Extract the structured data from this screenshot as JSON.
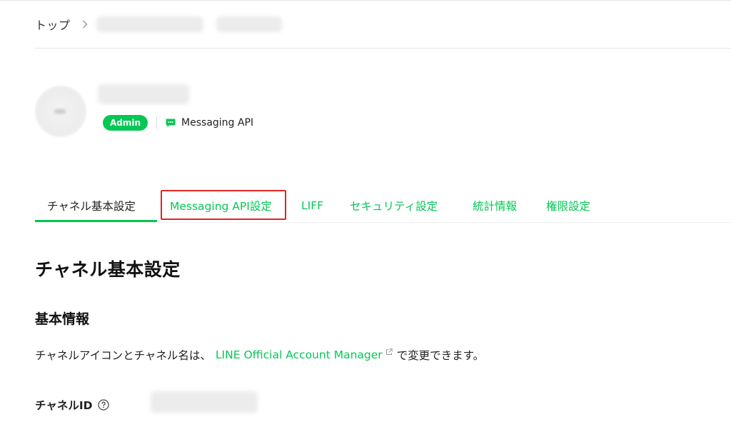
{
  "breadcrumb": {
    "home": "トップ"
  },
  "channel": {
    "role_badge": "Admin",
    "type": "Messaging API"
  },
  "tabs": [
    {
      "label": "チャネル基本設定",
      "active": true
    },
    {
      "label": "Messaging API設定",
      "active": false
    },
    {
      "label": "LIFF",
      "active": false
    },
    {
      "label": "セキュリティ設定",
      "active": false
    },
    {
      "label": "統計情報",
      "active": false
    },
    {
      "label": "権限設定",
      "active": false
    }
  ],
  "main": {
    "title": "チャネル基本設定",
    "section_title": "基本情報",
    "desc_before": "チャネルアイコンとチャネル名は、",
    "desc_link": "LINE Official Account Manager",
    "desc_after": "で変更できます。",
    "channel_id_label": "チャネルID"
  },
  "colors": {
    "accent": "#06c755",
    "highlight": "#e02525"
  }
}
